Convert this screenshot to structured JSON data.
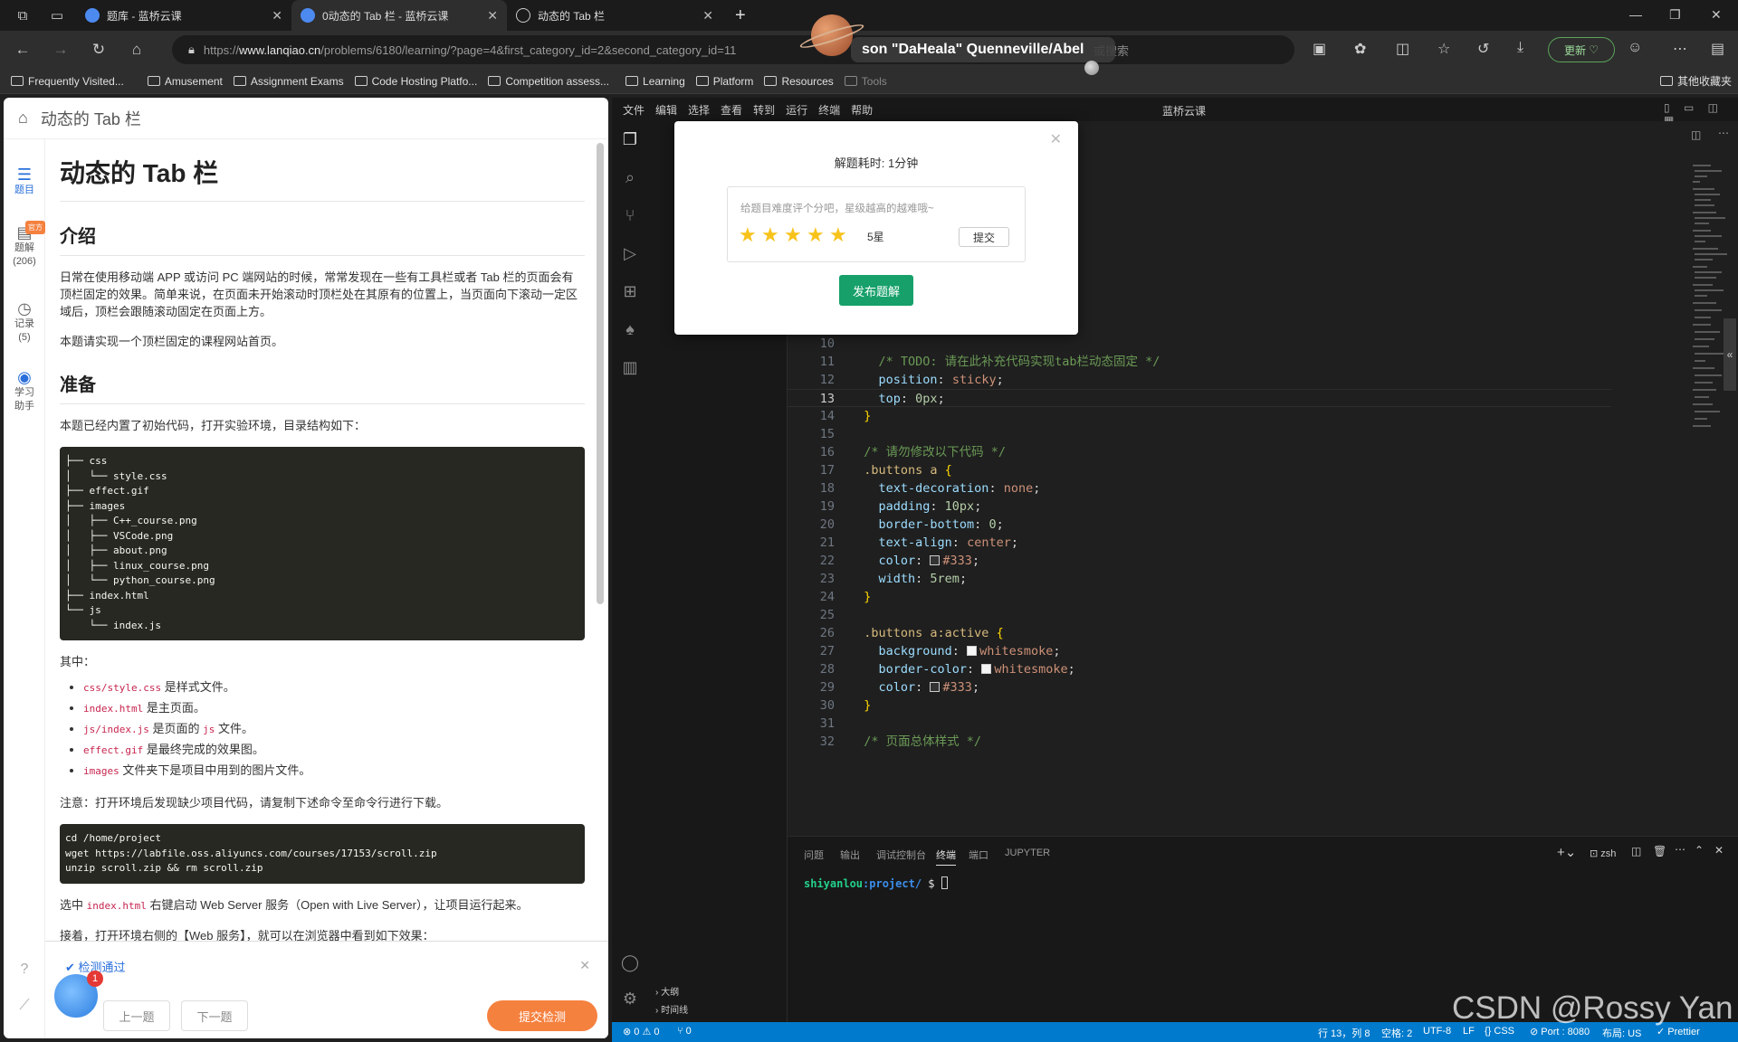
{
  "browser": {
    "tabs": [
      {
        "title": "题库 - 蓝桥云课",
        "favicon_color": "#4d8af0"
      },
      {
        "title": "0动态的 Tab 栏 - 蓝桥云课",
        "favicon_color": "#4d8af0"
      },
      {
        "title": "动态的 Tab 栏",
        "favicon_color": "#cccccc"
      }
    ],
    "active_tab": 1,
    "url": {
      "prefix": "https://",
      "host": "www.lanqiao.cn",
      "path": "/problems/6180/learning/?page=4&first_category_id=2&second_category_id=11"
    },
    "search_placeholder": "或搜索",
    "update_label": "更新",
    "bookmarks": [
      "Frequently Visited...",
      "Amusement",
      "Assignment Exams",
      "Code Hosting Platfo...",
      "Competition assess...",
      "Learning",
      "Platform",
      "Resources",
      "Tools"
    ],
    "other_bookmarks": "其他收藏夹"
  },
  "problem": {
    "header": "动态的 Tab 栏",
    "rail": {
      "tiku": "题目",
      "tijie": "题解",
      "tijie_count": "(206)",
      "official_badge": "官方",
      "jilu": "记录",
      "jilu_count": "(5)",
      "helper_line1": "学习",
      "helper_line2": "助手"
    },
    "title": "动态的 Tab 栏",
    "sections": {
      "intro_heading": "介绍",
      "intro_p1": "日常在使用移动端 APP 或访问 PC 端网站的时候，常常发现在一些有工具栏或者 Tab 栏的页面会有顶栏固定的效果。简单来说，在页面未开始滚动时顶栏处在其原有的位置上，当页面向下滚动一定区域后，顶栏会跟随滚动固定在页面上方。",
      "intro_p2": "本题请实现一个顶栏固定的课程网站首页。",
      "prep_heading": "准备",
      "prep_p1": "本题已经内置了初始代码，打开实验环境，目录结构如下：",
      "tree": "├── css\n│   └── style.css\n├── effect.gif\n├── images\n│   ├── C++_course.png\n│   ├── VSCode.png\n│   ├── about.png\n│   ├── linux_course.png\n│   └── python_course.png\n├── index.html\n└── js\n    └── index.js",
      "among": "其中：",
      "files": [
        {
          "code": "css/style.css",
          "desc": " 是样式文件。"
        },
        {
          "code": "index.html",
          "desc": " 是主页面。"
        },
        {
          "code": "js/index.js",
          "desc_pre": " 是页面的 ",
          "code2": "js",
          "desc": " 文件。"
        },
        {
          "code": "effect.gif",
          "desc": " 是最终完成的效果图。"
        },
        {
          "code": "images",
          "desc": " 文件夹下是项目中用到的图片文件。"
        }
      ],
      "note": "注意：打开环境后发现缺少项目代码，请复制下述命令至命令行进行下载。",
      "cmd": "cd /home/project\nwget https://labfile.oss.aliyuncs.com/courses/17153/scroll.zip\nunzip scroll.zip && rm scroll.zip",
      "select_pre": "选中 ",
      "select_code": "index.html",
      "select_post": " 右键启动 Web Server 服务（Open with Live Server），让项目运行起来。",
      "next_p": "接着，打开环境右侧的【Web 服务】，就可以在浏览器中看到如下效果："
    },
    "footer": {
      "check": "检测通过",
      "prev": "上一题",
      "next": "下一题",
      "submit": "提交检测",
      "badge": "1"
    }
  },
  "vscode": {
    "menu": [
      "文件",
      "编辑",
      "选择",
      "查看",
      "转到",
      "运行",
      "终端",
      "帮助"
    ],
    "title": "蓝桥云课",
    "side_labels": {
      "outline": "大纲",
      "timeline": "时间线"
    },
    "code_lines": [
      {
        "n": "10",
        "t": ""
      },
      {
        "n": "11",
        "t": "    /* TODO: 请在此补充代码实现tab栏动态固定 */"
      },
      {
        "n": "12",
        "t": "    position: sticky;"
      },
      {
        "n": "13",
        "t": "    top: 0px;"
      },
      {
        "n": "14",
        "t": "  }"
      },
      {
        "n": "15",
        "t": ""
      },
      {
        "n": "16",
        "t": "  /* 请勿修改以下代码 */"
      },
      {
        "n": "17",
        "t": "  .buttons a {"
      },
      {
        "n": "18",
        "t": "    text-decoration: none;"
      },
      {
        "n": "19",
        "t": "    padding: 10px;"
      },
      {
        "n": "20",
        "t": "    border-bottom: 0;"
      },
      {
        "n": "21",
        "t": "    text-align: center;"
      },
      {
        "n": "22",
        "t": "    color: #333;"
      },
      {
        "n": "23",
        "t": "    width: 5rem;"
      },
      {
        "n": "24",
        "t": "  }"
      },
      {
        "n": "25",
        "t": ""
      },
      {
        "n": "26",
        "t": "  .buttons a:active {"
      },
      {
        "n": "27",
        "t": "    background: whitesmoke;"
      },
      {
        "n": "28",
        "t": "    border-color: whitesmoke;"
      },
      {
        "n": "29",
        "t": "    color: #333;"
      },
      {
        "n": "30",
        "t": "  }"
      },
      {
        "n": "31",
        "t": ""
      },
      {
        "n": "32",
        "t": "  /* 页面总体样式 */"
      }
    ],
    "panel_tabs": [
      "问题",
      "输出",
      "调试控制台",
      "终端",
      "端口",
      "JUPYTER"
    ],
    "active_panel_tab": "终端",
    "terminal_shell": "zsh",
    "terminal_prompt_user": "shiyanlou",
    "terminal_prompt_path": ":project/",
    "terminal_prompt_sym": " $ ",
    "status": {
      "problems": "⊗ 0 ⚠ 0",
      "ports": "⑂ 0",
      "cursor": "行 13，列 8",
      "spaces": "空格: 2",
      "encoding": "UTF-8",
      "eol": "LF",
      "lang": "{} CSS",
      "port": "⊘ Port : 8080",
      "layout": "布局: US",
      "prettier": "✓ Prettier"
    }
  },
  "modal": {
    "title": "解题耗时: 1分钟",
    "hint": "给题目难度评个分吧，星级越高的越难哦~",
    "stars": 5,
    "star_label": "5星",
    "submit": "提交",
    "publish": "发布题解"
  },
  "overlay": {
    "media_text": "son \"DaHeala\" Quenneville/Abel",
    "watermark": "CSDN @Rossy Yan"
  },
  "colors": {
    "vscode_status": "#007acc",
    "accent_orange": "#f5813f",
    "publish_green": "#17a06a",
    "star": "#f7c31b"
  }
}
